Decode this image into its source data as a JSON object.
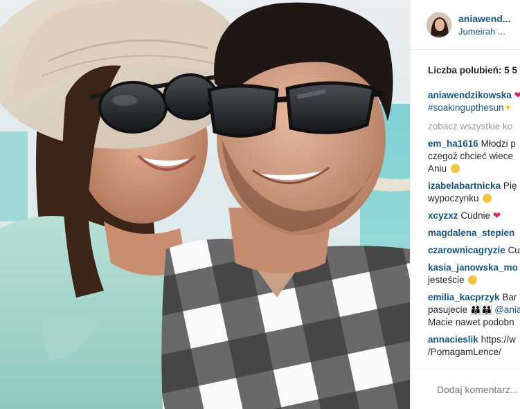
{
  "post": {
    "username": "aniawendzikowska",
    "username_short": "aniawend...",
    "location": "Jumeirah ...",
    "likes_text": "Liczba polubień: 5 5",
    "caption_hashtag": "#soakingupthesun",
    "view_all": "zobacz wszystkie ko"
  },
  "comments": [
    {
      "user": "em_ha1616",
      "lines": [
        "Młodzi p",
        "czegoż chcieć wiece",
        "Aniu"
      ]
    },
    {
      "user": "izabelabartnicka",
      "lines": [
        "Pię",
        "wypoczynku"
      ]
    },
    {
      "user": "xcyzxz",
      "lines": [
        "Cudnie"
      ]
    },
    {
      "user": "magdalena_stepien",
      "lines": []
    },
    {
      "user": "czarownicagryzie",
      "lines": [
        "Cu"
      ]
    },
    {
      "user": "kasia_janowska_mo",
      "lines": [
        "jesteście"
      ]
    },
    {
      "user": "emilia_kacprzyk",
      "lines": [
        "Bar",
        "pasujecie",
        "@ania",
        "Macie nawet podobn"
      ]
    },
    {
      "user": "annacieslik",
      "lines": [
        "https://w",
        "/PomagamLence/"
      ]
    }
  ],
  "footer": {
    "add_comment_placeholder": "Dodaj komentarz..."
  },
  "icons": {
    "like": "heart-outline-icon"
  },
  "colors": {
    "link": "#125688",
    "muted": "#999999",
    "text": "#262626"
  }
}
